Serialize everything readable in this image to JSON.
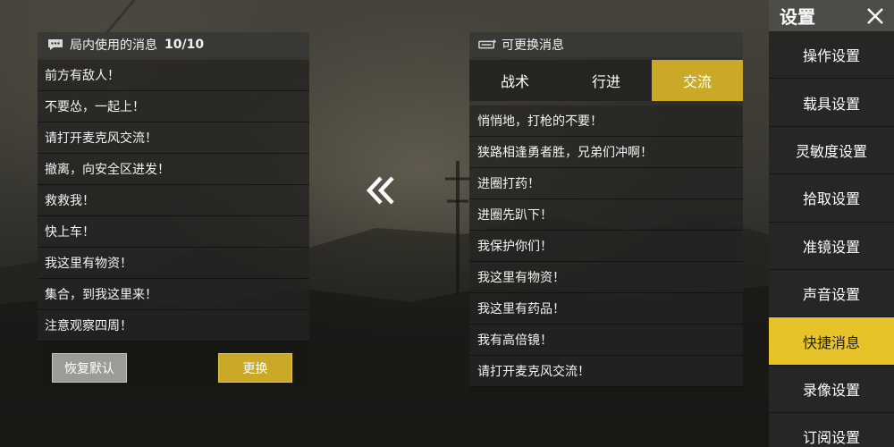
{
  "left_panel": {
    "title": "局内使用的消息",
    "count": "10/10",
    "messages": [
      "前方有敌人！",
      "不要怂，一起上！",
      "请打开麦克风交流！",
      "撤离，向安全区进发！",
      "救救我！",
      "快上车！",
      "我这里有物资！",
      "集合，到我这里来！",
      "注意观察四周！"
    ],
    "restore_label": "恢复默认",
    "replace_label": "更换"
  },
  "right_panel": {
    "title": "可更换消息",
    "tabs": [
      "战术",
      "行进",
      "交流"
    ],
    "active_tab": 2,
    "messages": [
      "悄悄地，打枪的不要！",
      "狭路相逢勇者胜，兄弟们冲啊！",
      "进圈打药！",
      "进圈先趴下！",
      "我保护你们！",
      "我这里有物资！",
      "我这里有药品！",
      "我有高倍镜！",
      "请打开麦克风交流！"
    ]
  },
  "sidebar": {
    "title": "设置",
    "items": [
      "操作设置",
      "载具设置",
      "灵敏度设置",
      "拾取设置",
      "准镜设置",
      "声音设置",
      "快捷消息",
      "录像设置",
      "订阅设置"
    ],
    "active_index": 6
  },
  "icons": {
    "left_header": "chat-bubble-icon",
    "right_header": "chat-swap-icon",
    "swap": "double-chevron-left-icon",
    "close": "close-icon"
  },
  "colors": {
    "accent": "#e6c429",
    "button_yellow": "#c9a925",
    "button_gray": "#9b9b98"
  }
}
